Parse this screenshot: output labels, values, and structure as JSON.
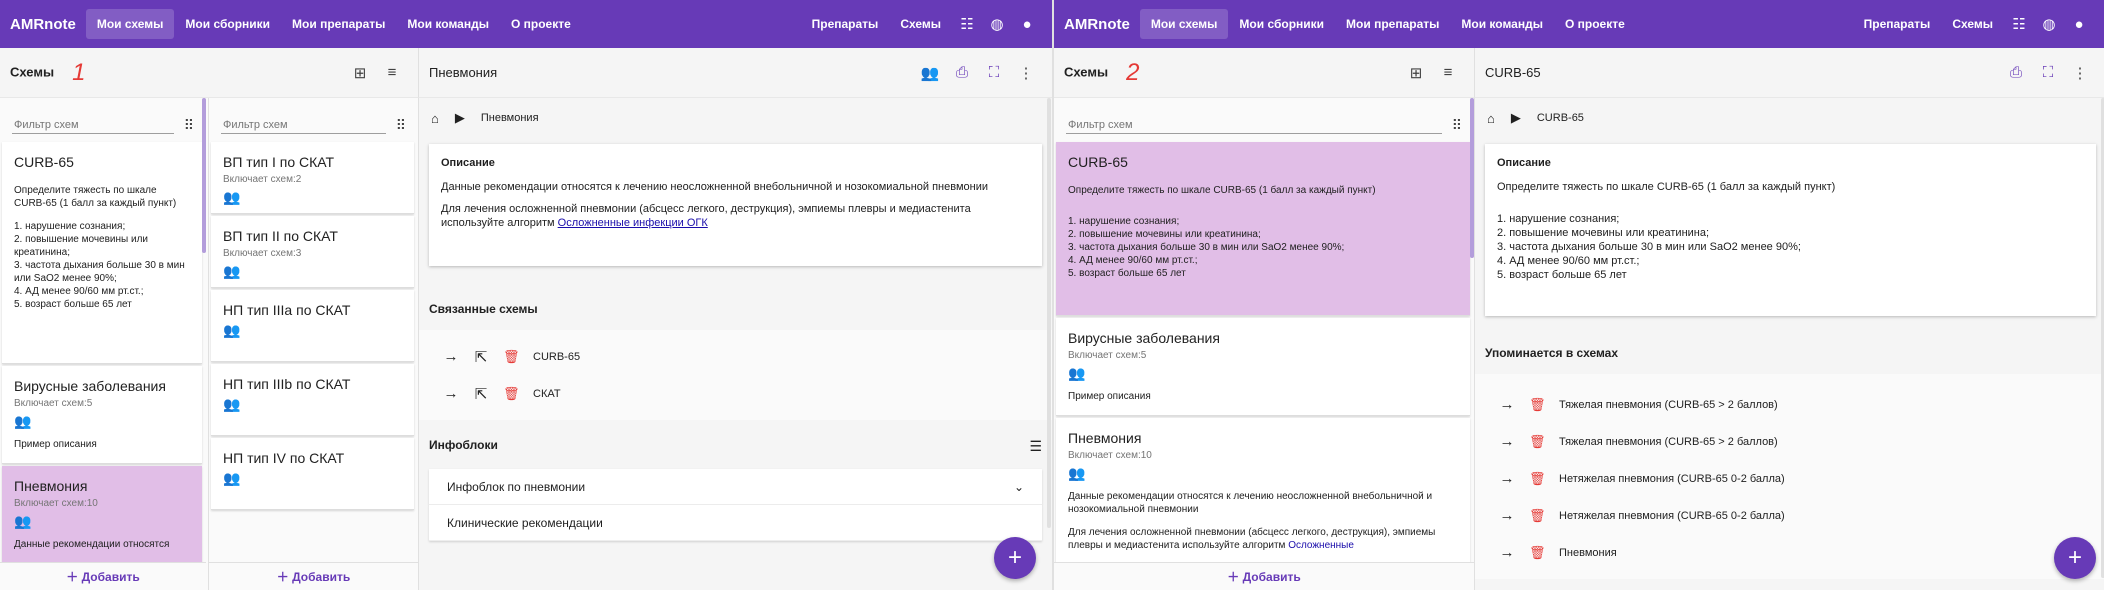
{
  "nav": {
    "logo": "AMRnote",
    "links": [
      "Мои схемы",
      "Мои сборники",
      "Мои препараты",
      "Мои команды",
      "О проекте"
    ],
    "right_links": [
      "Препараты",
      "Схемы"
    ]
  },
  "icons": {
    "tune": "tune-icon",
    "lang": "globe-icon",
    "user": "user-icon"
  },
  "left_toolbar": {
    "title": "Схемы",
    "number1": "1",
    "number2": "2"
  },
  "filter_placeholder": "Фильтр схем",
  "add_label": "Добавить",
  "curb": {
    "title": "CURB-65",
    "intro": "Определите тяжесть по шкале CURB-65 (1 балл за каждый пункт)",
    "criteria": [
      "1. нарушение сознания;",
      "2. повышение мочевины или креатинина;",
      "3. частота дыхания больше 30 в мин или SaO2 менее 90%;",
      "4. АД менее 90/60 мм рт.ст.;",
      "5. возраст больше 65 лет"
    ]
  },
  "viral": {
    "title": "Вирусные заболевания",
    "sub": "Включает схем:5",
    "desc": "Пример описания"
  },
  "pneu": {
    "title": "Пневмония",
    "sub": "Включает схем:10",
    "desc1": "Данные рекомендации относятся к лечению неосложненной внебольничной и нозокомиальной пневмонии",
    "desc2": "Для лечения осложненной пневмонии (абсцесс легкого, деструкция), эмпиемы плевры и медиастенита используйте алгоритм",
    "link": "Осложненные инфекции ОГК",
    "cut1": "Данные рекомендации относятся",
    "cut2": "эмпиемы плевры и медиастенита используйте алгоритм",
    "cut2link": "Осложненные"
  },
  "children": [
    {
      "title": "ВП тип I по СКАТ",
      "sub": "Включает схем:2"
    },
    {
      "title": "ВП тип II по СКАТ",
      "sub": "Включает схем:3"
    },
    {
      "title": "НП тип IIIa по СКАТ",
      "sub": ""
    },
    {
      "title": "НП тип IIIb по СКАТ",
      "sub": ""
    },
    {
      "title": "НП тип IV по СКАТ",
      "sub": ""
    }
  ],
  "panel1": {
    "title": "Пневмония",
    "breadcrumb": "Пневмония",
    "desc_heading": "Описание",
    "related_heading": "Связанные схемы",
    "related": [
      "CURB-65",
      "СКАТ"
    ],
    "infoblocks_heading": "Инфоблоки",
    "infoblocks": [
      "Инфоблок по пневмонии",
      "Клинические рекомендации"
    ]
  },
  "panel2": {
    "title": "CURB-65",
    "breadcrumb": "CURB-65",
    "desc_heading": "Описание",
    "mentions_heading": "Упоминается в схемах",
    "mentions": [
      "Тяжелая пневмония (CURB-65 > 2 баллов)",
      "Тяжелая пневмония (CURB-65 > 2 баллов)",
      "Нетяжелая пневмония (CURB-65 0-2 балла)",
      "Нетяжелая пневмония (CURB-65 0-2 балла)",
      "Пневмония"
    ]
  },
  "fab_label": "+"
}
